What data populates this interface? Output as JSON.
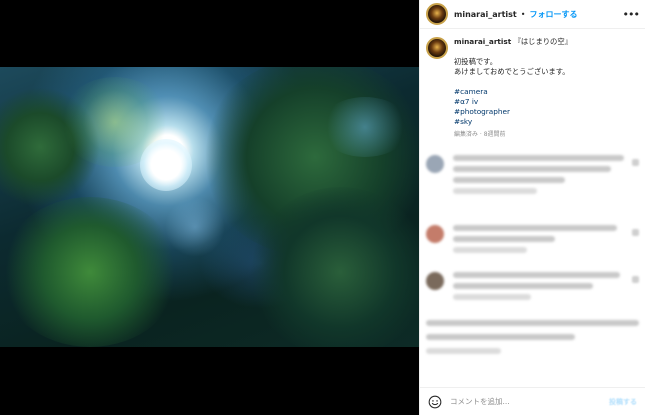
{
  "post": {
    "username": "minarai_artist",
    "separator": "•",
    "follow_label": "フォローする",
    "more_label": "•••",
    "caption_title": "『はじまりの空』",
    "caption_lines": [
      "初投稿です。",
      "あけましておめでとうございます。"
    ],
    "hashtags": [
      "#camera",
      "#α7 iv",
      "#photographer",
      "#sky"
    ],
    "meta": "編集済み · 8週間前"
  },
  "comment_box": {
    "placeholder": "コメントを追加...",
    "post_label": "投稿する"
  },
  "colors": {
    "accent": "#0095f6",
    "text": "#262626",
    "muted": "#8e8e8e"
  }
}
